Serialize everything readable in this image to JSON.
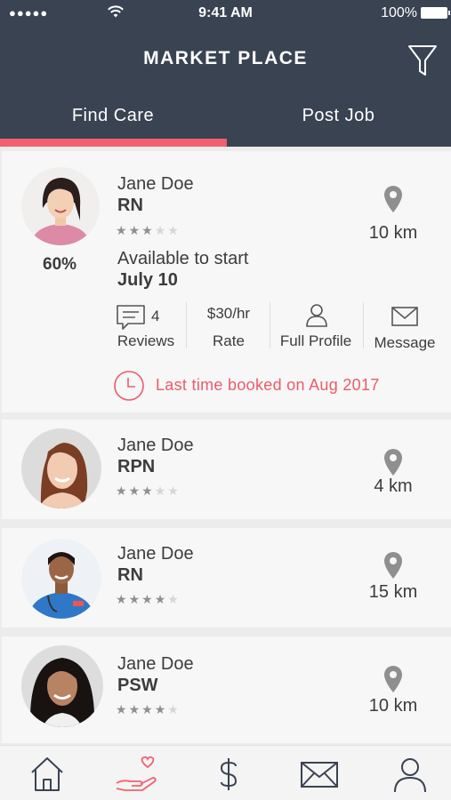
{
  "status_bar": {
    "signal": "●●●●●",
    "time": "9:41 AM",
    "battery": "100%"
  },
  "header": {
    "title": "MARKET PLACE",
    "tabs": [
      {
        "label": "Find Care",
        "active": true
      },
      {
        "label": "Post Job",
        "active": false
      }
    ]
  },
  "colors": {
    "header_bg": "#3a4352",
    "accent": "#f2606e",
    "booked_text": "#ee5a6a"
  },
  "caregivers": [
    {
      "name": "Jane Doe",
      "role": "RN",
      "rating": 3,
      "rating_max": 5,
      "distance": "10 km",
      "match": "60%",
      "available_label": "Available to start",
      "available_date": "July 10",
      "actions": {
        "reviews_count": "4",
        "reviews_label": "Reviews",
        "rate_value": "$30/hr",
        "rate_label": "Rate",
        "profile_label": "Full Profile",
        "message_label": "Message"
      },
      "last_booked": "Last time booked on Aug 2017"
    },
    {
      "name": "Jane Doe",
      "role": "RPN",
      "rating": 3,
      "rating_max": 5,
      "distance": "4 km"
    },
    {
      "name": "Jane Doe",
      "role": "RN",
      "rating": 4,
      "rating_max": 5,
      "distance": "15 km"
    },
    {
      "name": "Jane Doe",
      "role": "PSW",
      "rating": 4,
      "rating_max": 5,
      "distance": "10 km"
    }
  ],
  "bottom_nav": [
    {
      "icon": "home-icon",
      "active": false
    },
    {
      "icon": "care-hand-heart-icon",
      "active": true
    },
    {
      "icon": "dollar-icon",
      "active": false
    },
    {
      "icon": "mail-icon",
      "active": false
    },
    {
      "icon": "user-icon",
      "active": false
    }
  ]
}
